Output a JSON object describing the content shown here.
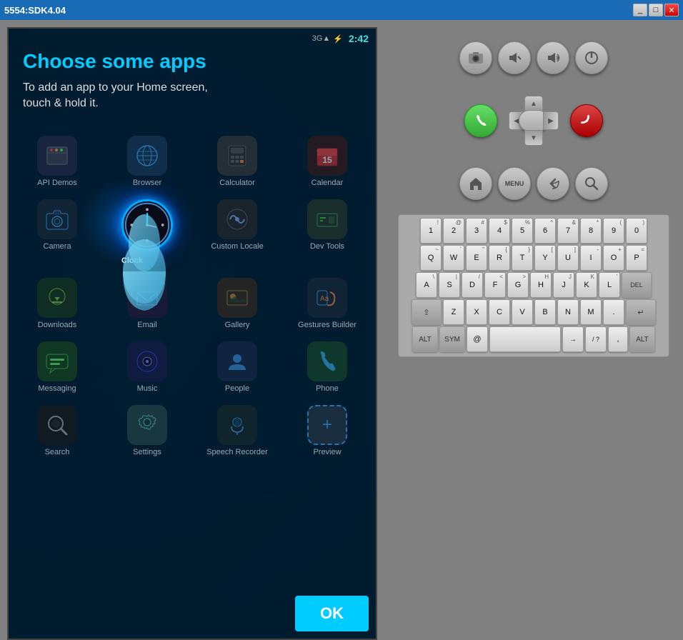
{
  "window": {
    "title": "5554:SDK4.04"
  },
  "status_bar": {
    "network": "3G",
    "time": "2:42"
  },
  "chooser": {
    "title": "Choose some apps",
    "subtitle": "To add an app to your Home screen,\ntouch & hold it."
  },
  "apps": [
    {
      "id": "api-demos",
      "label": "API Demos",
      "icon": "📱"
    },
    {
      "id": "browser",
      "label": "Browser",
      "icon": "🌐"
    },
    {
      "id": "calculator",
      "label": "Calculator",
      "icon": "🔢"
    },
    {
      "id": "calendar",
      "label": "Calendar",
      "icon": "📅"
    },
    {
      "id": "camera",
      "label": "Camera",
      "icon": "📷"
    },
    {
      "id": "clock",
      "label": "Clock",
      "icon": "🕐"
    },
    {
      "id": "custom-locale",
      "label": "Custom Locale",
      "icon": "⚙️"
    },
    {
      "id": "dev-tools",
      "label": "Dev Tools",
      "icon": "🔧"
    },
    {
      "id": "downloads",
      "label": "Downloads",
      "icon": "⬇️"
    },
    {
      "id": "email",
      "label": "Email",
      "icon": "✉️"
    },
    {
      "id": "gallery",
      "label": "Gallery",
      "icon": "🖼️"
    },
    {
      "id": "gestures-builder",
      "label": "Gestures Builder",
      "icon": "✋"
    },
    {
      "id": "messaging",
      "label": "Messaging",
      "icon": "💬"
    },
    {
      "id": "music",
      "label": "Music",
      "icon": "🎵"
    },
    {
      "id": "people",
      "label": "People",
      "icon": "👥"
    },
    {
      "id": "phone",
      "label": "Phone",
      "icon": "📞"
    },
    {
      "id": "search",
      "label": "Search",
      "icon": "🔍"
    },
    {
      "id": "settings",
      "label": "Settings",
      "icon": "⚙️"
    },
    {
      "id": "speech-recorder",
      "label": "Speech Recorder",
      "icon": "🎙️"
    },
    {
      "id": "preview",
      "label": "Preview",
      "icon": "👁️"
    }
  ],
  "ok_button": "OK",
  "keyboard": {
    "rows": [
      [
        "1!",
        "2@",
        "3#",
        "4$",
        "5%",
        "6^",
        "7&",
        "8*",
        "9(",
        "0)"
      ],
      [
        "Q~",
        "W`",
        "E\"",
        "R{",
        "T}",
        "Y[",
        "U]",
        "I-",
        "O+",
        "P="
      ],
      [
        "A\\",
        "S|",
        "D/",
        "F<",
        "G>",
        "H?",
        "J:",
        "K;",
        "L'"
      ],
      [
        "Z",
        "X",
        "C",
        "V",
        "B",
        "N",
        "M",
        "."
      ],
      [
        "ALT",
        "SYM",
        "@",
        "SPACE",
        "→",
        "/ ?",
        ",",
        "ALT"
      ]
    ]
  },
  "controls": {
    "camera_label": "📷",
    "vol_down_label": "🔉",
    "vol_up_label": "🔊",
    "power_label": "⏻",
    "call_label": "📞",
    "end_call_label": "📞",
    "home_label": "🏠",
    "menu_label": "MENU",
    "back_label": "↩",
    "search_label": "🔍"
  }
}
